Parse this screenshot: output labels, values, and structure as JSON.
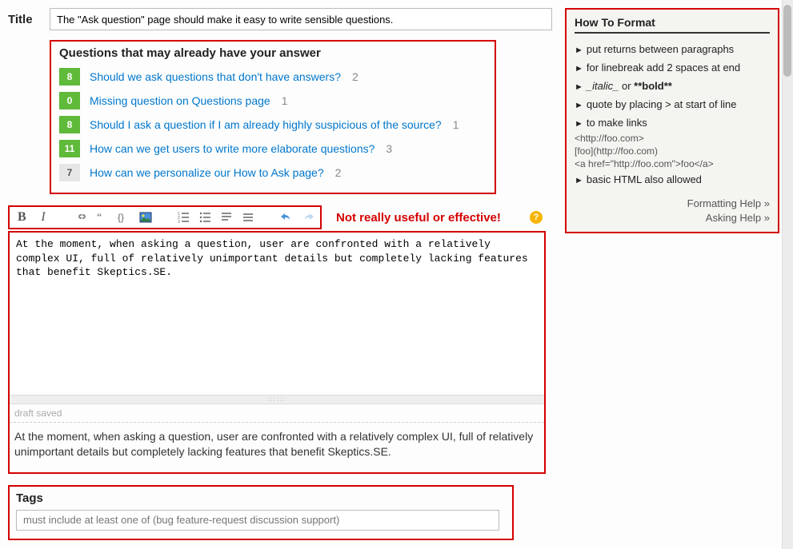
{
  "title_label": "Title",
  "title_value": "The \"Ask question\" page should make it easy to write sensible questions.",
  "duplicates": {
    "heading": "Questions that may already have your answer",
    "items": [
      {
        "count": "8",
        "count_class": "green",
        "text": "Should we ask questions that don't have answers?",
        "answers": "2"
      },
      {
        "count": "0",
        "count_class": "green",
        "text": "Missing question on Questions page",
        "answers": "1"
      },
      {
        "count": "8",
        "count_class": "green",
        "text": "Should I ask a question if I am already highly suspicious of the source?",
        "answers": "1"
      },
      {
        "count": "11",
        "count_class": "green",
        "text": "How can we get users to write more elaborate questions?",
        "answers": "3"
      },
      {
        "count": "7",
        "count_class": "gray",
        "text": "How can we personalize our How to Ask page?",
        "answers": "2"
      }
    ]
  },
  "annotation": "Not really useful or effective!",
  "editor_text": "At the moment, when asking a question, user are confronted with a relatively complex UI, full of relatively unimportant details but completely lacking features that benefit Skeptics.SE.",
  "draft_status": "draft saved",
  "preview_text": "At the moment, when asking a question, user are confronted with a relatively complex UI, full of relatively unimportant details but completely lacking features that benefit Skeptics.SE.",
  "tags": {
    "label": "Tags",
    "placeholder": "must include at least one of (bug feature-request discussion support)"
  },
  "howto": {
    "title": "How To Format",
    "items": [
      "put returns between paragraphs",
      "for linebreak add 2 spaces at end",
      "_italic_ or **bold**",
      "quote by placing > at start of line",
      "to make links"
    ],
    "link_examples": [
      "<http://foo.com>",
      "[foo](http://foo.com)",
      "<a href=\"http://foo.com\">foo</a>"
    ],
    "items2": [
      "basic HTML also allowed"
    ],
    "help_links": [
      "Formatting Help »",
      "Asking Help »"
    ]
  },
  "toolbar": {
    "bold": "B",
    "italic": "I"
  },
  "help_q": "?"
}
